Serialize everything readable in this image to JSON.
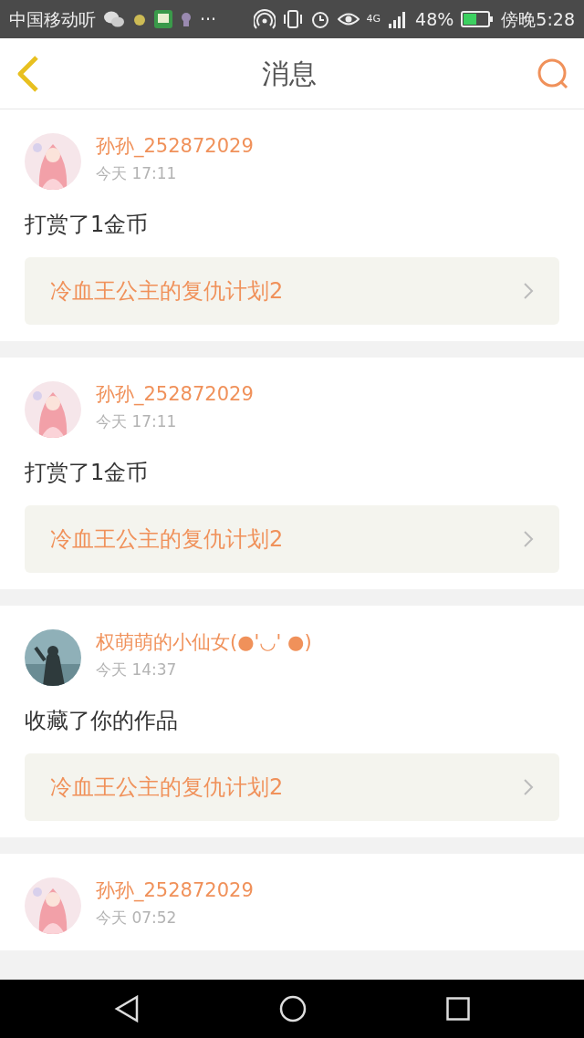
{
  "status_bar": {
    "carrier": "中国移动听",
    "more": "···",
    "network": "4G",
    "battery": "48%",
    "time": "傍晚5:28"
  },
  "header": {
    "title": "消息"
  },
  "messages": [
    {
      "user": "孙孙_252872029",
      "time": "今天 17:11",
      "text": "打赏了1金币",
      "work": "冷血王公主的复仇计划2"
    },
    {
      "user": "孙孙_252872029",
      "time": "今天 17:11",
      "text": "打赏了1金币",
      "work": "冷血王公主的复仇计划2"
    },
    {
      "user": "权萌萌的小仙女(●'◡' ●)",
      "time": "今天 14:37",
      "text": "收藏了你的作品",
      "work": "冷血王公主的复仇计划2"
    },
    {
      "user": "孙孙_252872029",
      "time": "今天 07:52"
    }
  ]
}
